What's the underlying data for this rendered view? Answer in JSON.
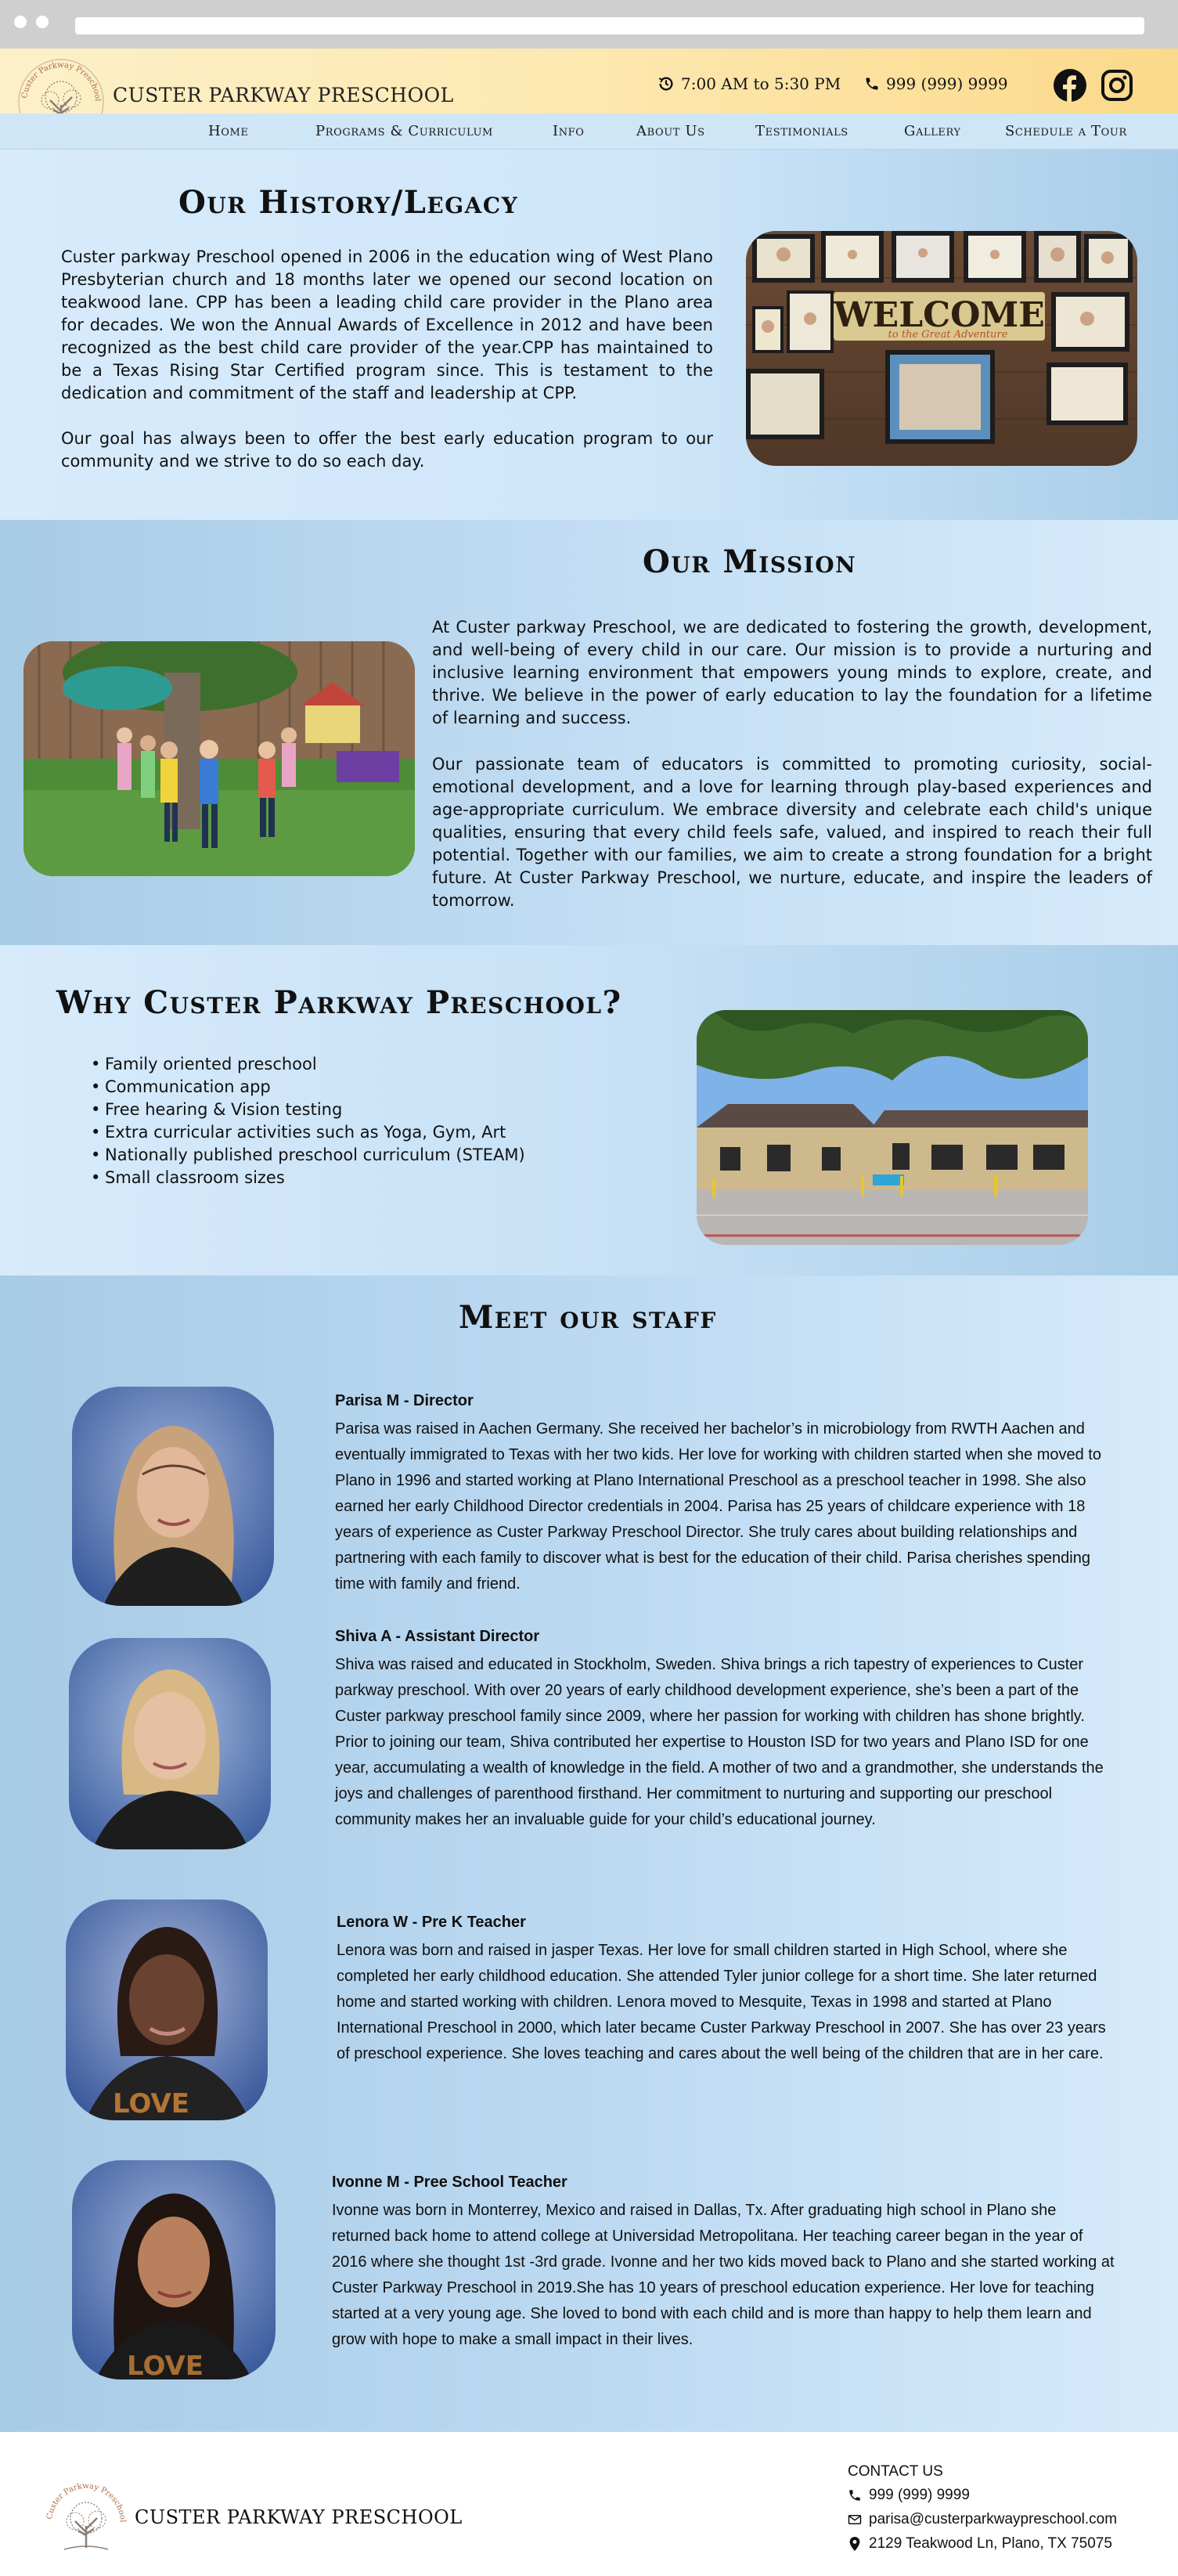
{
  "brand": {
    "name": "CUSTER PARKWAY PRESCHOOL",
    "logo_text": "Custer Parkway Preschool"
  },
  "header": {
    "hours": "7:00 AM to 5:30 PM",
    "phone": "999 (999) 9999",
    "icons": [
      "clock-icon",
      "phone-icon",
      "facebook-icon",
      "instagram-icon"
    ]
  },
  "nav": {
    "items": [
      "Home",
      "Programs & Curriculum",
      "Info",
      "About Us",
      "Testimonials",
      "Gallery",
      "Schedule a Tour"
    ]
  },
  "history": {
    "title": "Our History/Legacy",
    "p1": "Custer parkway Preschool opened in 2006 in the education wing of West Plano Presbyterian church and 18 months later we opened our second location on teakwood lane. CPP has been a leading child care provider in the Plano area for decades. We won the Annual Awards of Excellence in 2012 and have been recognized as the best child care provider of the year.CPP has maintained to be a Texas Rising Star Certified program since. This is testament to the dedication and commitment of the staff and leadership at CPP.",
    "p2": "Our goal has always been to offer the best early education program to our community and we strive to do so each day.",
    "sign_text": "WELCOME",
    "sign_sub": "to the Great Adventure"
  },
  "mission": {
    "title": "Our Mission",
    "p1": "At Custer parkway Preschool, we are dedicated to fostering the growth, development, and well-being of every child in our care. Our mission is to provide a nurturing and inclusive learning environment that empowers young minds to explore, create, and thrive. We believe in the power of early education to lay the foundation for a lifetime of learning and success.",
    "p2": "Our passionate team of educators is committed to promoting curiosity, social-emotional development, and a love for learning through play-based experiences and age-appropriate curriculum. We embrace diversity and celebrate each child's unique qualities, ensuring that every child feels safe, valued, and inspired to reach their full potential. Together with our families, we aim to create a strong foundation for a bright future. At Custer Parkway Preschool, we nurture, educate, and inspire the leaders of tomorrow."
  },
  "why": {
    "title": "Why Custer Parkway Preschool?",
    "items": [
      "Family oriented preschool",
      "Communication app",
      "Free hearing & Vision testing",
      "Extra curricular activities such as Yoga, Gym, Art",
      "Nationally published preschool curriculum (STEAM)",
      "Small classroom sizes"
    ]
  },
  "staff": {
    "title": "Meet our staff",
    "members": [
      {
        "name": "Parisa M - Director",
        "bio": "Parisa was raised in Aachen Germany. She received her bachelor’s in microbiology from RWTH Aachen and eventually immigrated to Texas with her two kids. Her love for working with children started when she moved to Plano in 1996 and started working at Plano International Preschool as a preschool teacher in 1998. She also earned her early Childhood Director credentials in 2004. Parisa has 25 years of childcare experience with 18 years of experience as Custer Parkway Preschool Director. She truly cares about building relationships and partnering with each family to discover what is best for the education of their child. Parisa cherishes spending time with family and friend."
      },
      {
        "name": "Shiva A - Assistant Director",
        "bio": "Shiva was raised and educated in Stockholm, Sweden. Shiva brings a rich tapestry of experiences to Custer parkway preschool. With over 20 years of early childhood development experience, she’s been a part of the Custer parkway preschool family since 2009, where her passion for working with children has shone brightly. Prior to joining our team, Shiva contributed her expertise to Houston ISD for two years and Plano ISD for one year, accumulating a wealth of knowledge in the field. A mother of two and a grandmother, she understands the joys and challenges of parenthood firsthand. Her commitment to nurturing and supporting our preschool community makes her an invaluable guide for your child’s educational journey."
      },
      {
        "name": "Lenora W - Pre K Teacher",
        "bio": "Lenora was born and raised in jasper Texas. Her love for small children started in High School, where she completed her early childhood education. She attended Tyler junior college for a short time. She later returned home and started working with children. Lenora moved to Mesquite, Texas in 1998 and started at Plano International Preschool in 2000, which later became Custer Parkway Preschool in 2007. She has over 23 years of preschool experience. She loves teaching and cares about the well being of the children that are in her care."
      },
      {
        "name": "Ivonne  M - Pree School Teacher",
        "bio": "Ivonne was born in Monterrey, Mexico and raised in Dallas, Tx. After graduating high school in Plano she returned back home to attend college at Universidad Metropolitana. Her teaching career began in the year of 2016 where she thought 1st -3rd grade. Ivonne and her two kids moved back to Plano and she started working at Custer Parkway Preschool in 2019.She has 10 years of preschool education experience. Her love for teaching started at a very young age. She loved to bond with each child and is more than happy to help them learn and grow with hope to make a small impact in their lives."
      }
    ]
  },
  "footer": {
    "brand": "CUSTER PARKWAY PRESCHOOL",
    "contact_heading": "CONTACT US",
    "phone": "999 (999) 9999",
    "email": "parisa@custerparkwaypreschool.com",
    "address": "2129 Teakwood Ln, Plano, TX 75075"
  },
  "colors": {
    "accent_gold": "#fbd98a",
    "sky_blue": "#cfe6f7",
    "text": "#111111"
  }
}
